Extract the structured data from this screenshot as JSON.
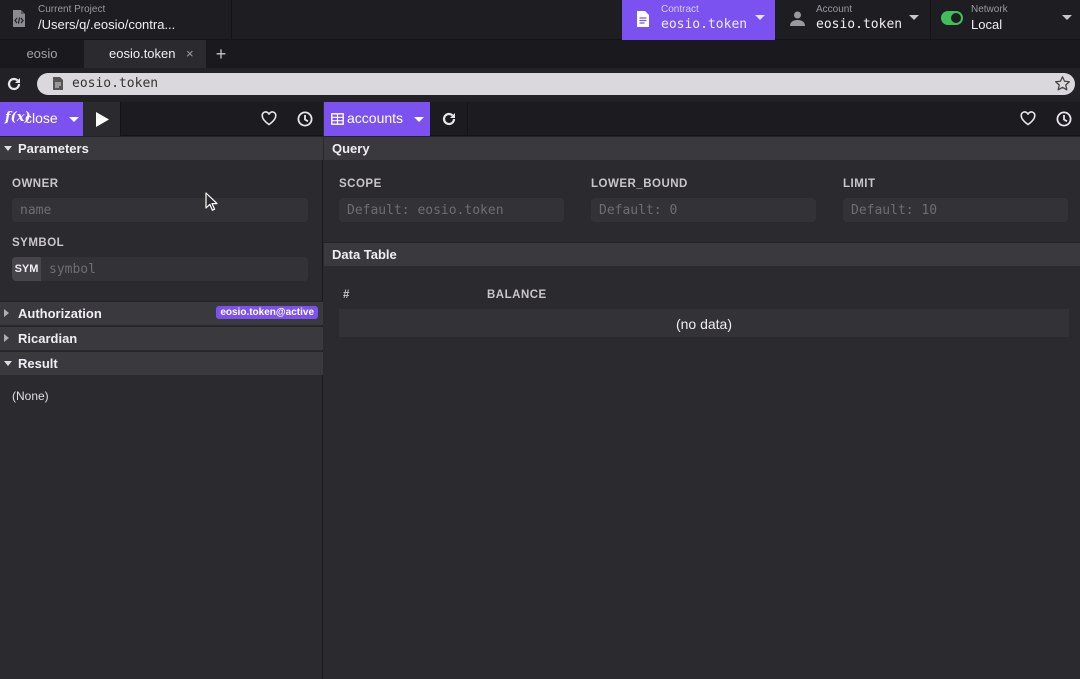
{
  "topbar": {
    "project": {
      "caption": "Current Project",
      "value": "/Users/q/.eosio/contra..."
    },
    "contract": {
      "caption": "Contract",
      "value": "eosio.token"
    },
    "account": {
      "caption": "Account",
      "value": "eosio.token"
    },
    "network": {
      "caption": "Network",
      "value": "Local"
    }
  },
  "tabs": [
    {
      "label": "eosio"
    },
    {
      "label": "eosio.token"
    }
  ],
  "tab_add_label": "+",
  "tab_close_label": "×",
  "address": {
    "url": "eosio.token"
  },
  "left": {
    "function_name": "close",
    "fx_label": "f(x)",
    "sections": {
      "parameters": "Parameters",
      "authorization": "Authorization",
      "ricardian": "Ricardian",
      "result": "Result"
    },
    "owner": {
      "label": "OWNER",
      "placeholder": "name"
    },
    "symbol": {
      "label": "SYMBOL",
      "prefix": "SYM",
      "placeholder": "symbol"
    },
    "authorization_badge": "eosio.token@active",
    "result_text": "(None)"
  },
  "right": {
    "table_name": "accounts",
    "query_header": "Query",
    "scope": {
      "label": "SCOPE",
      "placeholder": "Default: eosio.token"
    },
    "lower_bound": {
      "label": "LOWER_BOUND",
      "placeholder": "Default: 0"
    },
    "limit": {
      "label": "LIMIT",
      "placeholder": "Default: 10"
    },
    "data_table_header": "Data Table",
    "columns": [
      "#",
      "BALANCE"
    ],
    "empty_text": "(no data)"
  },
  "colors": {
    "accent": "#7b52f0",
    "network_toggle": "#3fbf5a"
  },
  "icons": [
    "file-code-icon",
    "document-icon",
    "user-icon",
    "toggle-icon",
    "refresh-icon",
    "star-icon",
    "fx-icon",
    "play-icon",
    "heart-icon",
    "clock-icon",
    "table-icon",
    "cursor-icon"
  ]
}
